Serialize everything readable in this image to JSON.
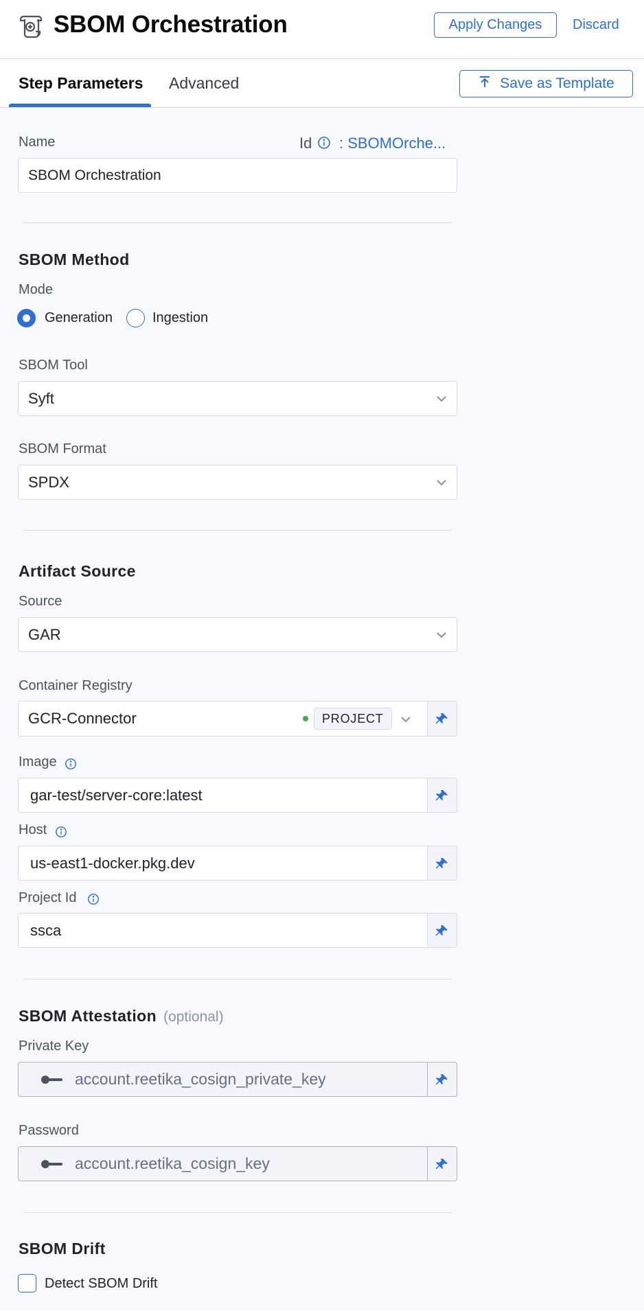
{
  "header": {
    "title": "SBOM Orchestration",
    "icon": "scroll-plus-icon",
    "apply_label": "Apply Changes",
    "discard_label": "Discard"
  },
  "tabs": {
    "items": [
      {
        "label": "Step Parameters",
        "active": true
      },
      {
        "label": "Advanced",
        "active": false
      }
    ],
    "save_template_label": "Save as Template"
  },
  "name_field": {
    "label": "Name",
    "value": "SBOM Orchestration",
    "id_label": "Id",
    "id_value": ": SBOMOrche..."
  },
  "sbom_method": {
    "title": "SBOM Method",
    "mode_label": "Mode",
    "modes": [
      {
        "label": "Generation",
        "selected": true
      },
      {
        "label": "Ingestion",
        "selected": false
      }
    ],
    "tool_label": "SBOM Tool",
    "tool_value": "Syft",
    "format_label": "SBOM Format",
    "format_value": "SPDX"
  },
  "artifact_source": {
    "title": "Artifact Source",
    "source_label": "Source",
    "source_value": "GAR",
    "registry_label": "Container Registry",
    "registry_value": "GCR-Connector",
    "registry_scope": "PROJECT",
    "image_label": "Image",
    "image_value": "gar-test/server-core:latest",
    "host_label": "Host",
    "host_value": "us-east1-docker.pkg.dev",
    "project_label": "Project Id",
    "project_value": "ssca"
  },
  "attestation": {
    "title": "SBOM Attestation",
    "optional": "(optional)",
    "private_key_label": "Private Key",
    "private_key_value": "account.reetika_cosign_private_key",
    "password_label": "Password",
    "password_value": "account.reetika_cosign_key"
  },
  "drift": {
    "title": "SBOM Drift",
    "checkbox_label": "Detect SBOM Drift",
    "checked": false
  },
  "colors": {
    "primary": "#2f6fd0",
    "connected": "#42ab45",
    "background": "#f7f9fc",
    "border": "#d9dae5"
  }
}
